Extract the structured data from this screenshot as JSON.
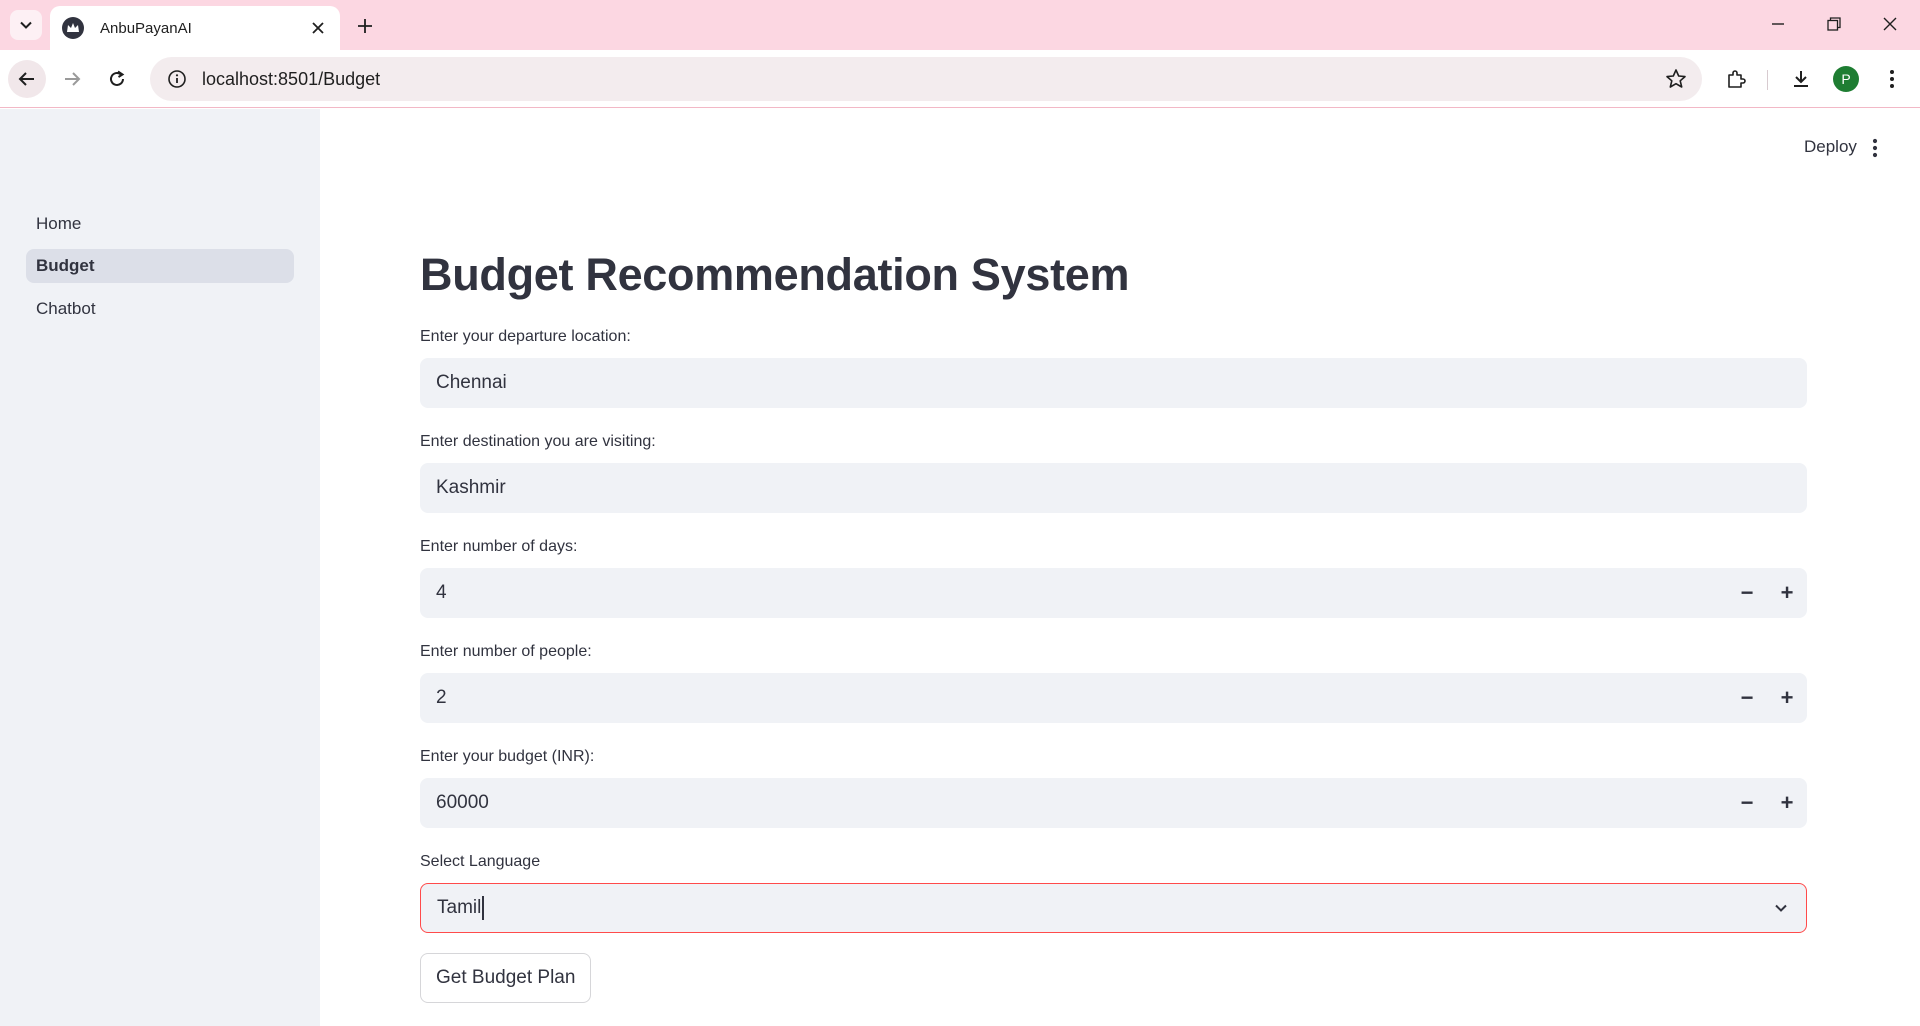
{
  "browser": {
    "tab_title": "AnbuPayanAI",
    "url": "localhost:8501/Budget",
    "profile_initial": "P",
    "accent_color": "#fcd7e2"
  },
  "sidebar": {
    "items": [
      {
        "label": "Home",
        "active": false
      },
      {
        "label": "Budget",
        "active": true
      },
      {
        "label": "Chatbot",
        "active": false
      }
    ]
  },
  "header": {
    "deploy_label": "Deploy"
  },
  "main": {
    "title": "Budget Recommendation System",
    "fields": {
      "departure": {
        "label": "Enter your departure location:",
        "value": "Chennai"
      },
      "destination": {
        "label": "Enter destination you are visiting:",
        "value": "Kashmir"
      },
      "days": {
        "label": "Enter number of days:",
        "value": "4"
      },
      "people": {
        "label": "Enter number of people:",
        "value": "2"
      },
      "budget": {
        "label": "Enter your budget (INR):",
        "value": "60000"
      },
      "language": {
        "label": "Select Language",
        "value": "Tamil"
      }
    },
    "stepper_minus": "−",
    "stepper_plus": "+",
    "submit_label": "Get Budget Plan",
    "focus_border_color": "#ff4b4b"
  }
}
